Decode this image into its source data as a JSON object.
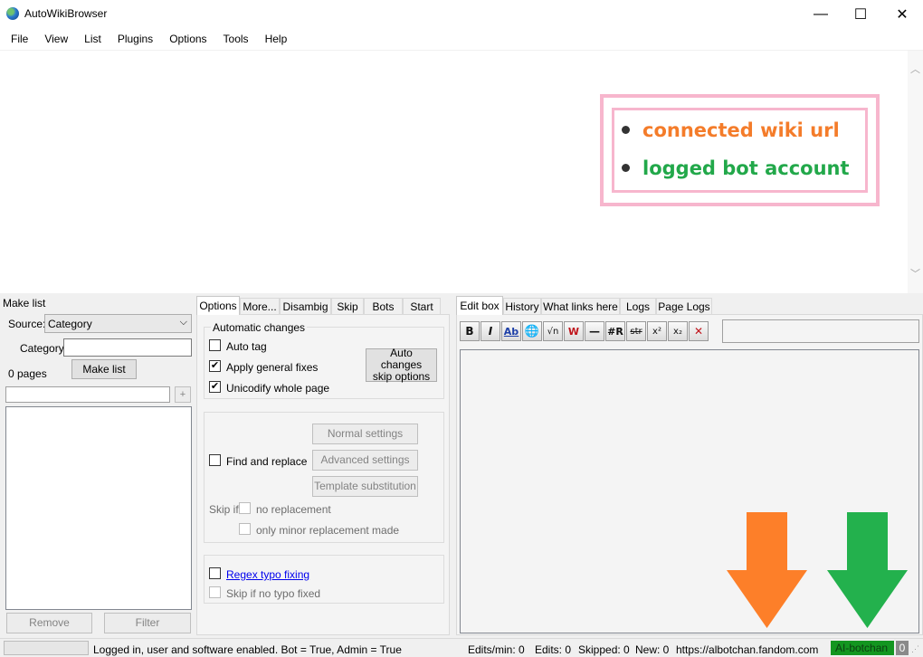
{
  "window": {
    "title": "AutoWikiBrowser",
    "minimize": "—",
    "maximize": "☐",
    "close": "✕"
  },
  "menu": [
    "File",
    "View",
    "List",
    "Plugins",
    "Options",
    "Tools",
    "Help"
  ],
  "annotation": {
    "items": [
      {
        "text": "connected wiki url",
        "color": "#f47c2a"
      },
      {
        "text": "logged bot account",
        "color": "#22a84a"
      }
    ]
  },
  "make_list": {
    "heading": "Make list",
    "source_label": "Source:",
    "source_value": "Category",
    "category_label": "Category:",
    "category_value": "",
    "pages_count": "0 pages",
    "make_list_button": "Make list",
    "filter_input": "",
    "add_button": "+",
    "remove_button": "Remove",
    "filter_button": "Filter"
  },
  "options_tabs": [
    "Options",
    "More...",
    "Disambig",
    "Skip",
    "Bots",
    "Start"
  ],
  "options": {
    "automatic_changes_title": "Automatic changes",
    "auto_tag": "Auto tag",
    "apply_general_fixes": "Apply general fixes",
    "unicodify": "Unicodify whole page",
    "check_mark": "✔",
    "auto_changes_skip_button": "Auto changes skip options",
    "find_and_replace": "Find and replace",
    "normal_settings": "Normal settings",
    "advanced_settings": "Advanced settings",
    "template_substitution": "Template substitution",
    "skip_if": "Skip if",
    "no_replacement": "no replacement",
    "only_minor": "only minor replacement made",
    "regex_typo": "Regex typo fixing",
    "skip_no_typo": "Skip if no typo fixed"
  },
  "edit_tabs": [
    "Edit box",
    "History",
    "What links here",
    "Logs",
    "Page Logs"
  ],
  "toolbar": [
    "B",
    "I",
    "Ab",
    "🌐",
    "√n",
    "W",
    "—",
    "#R",
    "str",
    "x²",
    "x₂",
    "✕"
  ],
  "status": {
    "message": "Logged in, user and software enabled. Bot = True, Admin = True",
    "edits_min": "Edits/min: 0",
    "edits": "Edits: 0",
    "skipped": "Skipped: 0",
    "new": "New: 0",
    "wiki_url": "https://albotchan.fandom.com",
    "bot_account": "AI-botchan",
    "counter": "0"
  },
  "colors": {
    "orange_arrow": "#fd7f29",
    "green_arrow": "#23b14d",
    "account_badge": "#139620"
  }
}
